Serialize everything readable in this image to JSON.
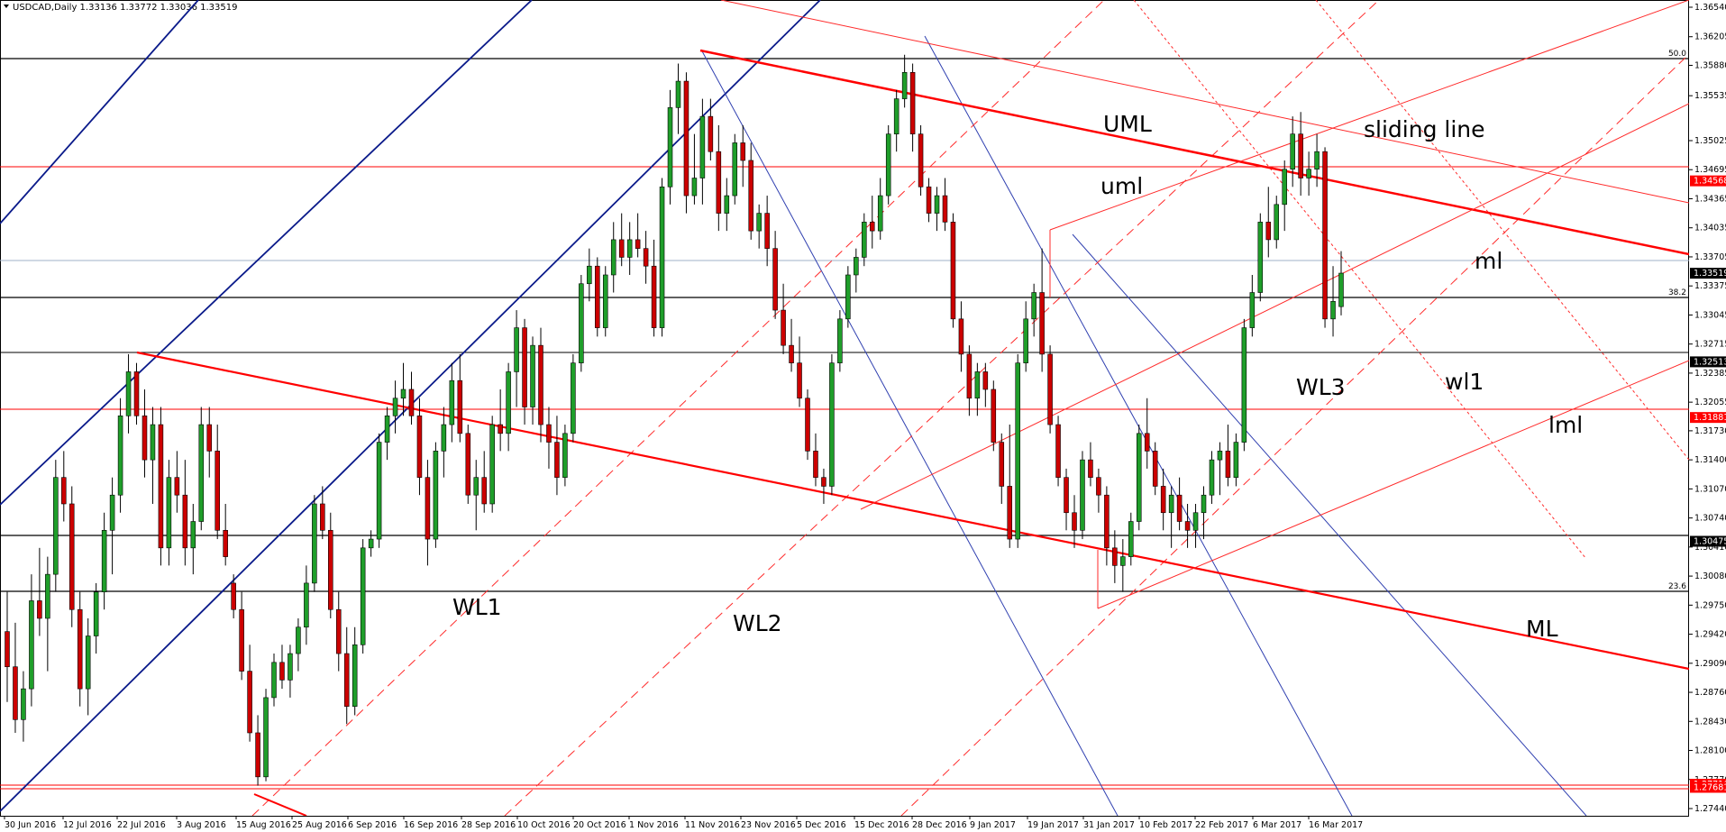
{
  "chart_data": {
    "type": "candlestick",
    "title": "USDCAD,Daily  1.33136 1.33772 1.33036 1.33519",
    "ylim": [
      1.2744,
      1.3654
    ],
    "price_ticks": [
      "1.36540",
      "1.36205",
      "1.35880",
      "1.35535",
      "1.35025",
      "1.34695",
      "1.34365",
      "1.34035",
      "1.33705",
      "1.33375",
      "1.33045",
      "1.32715",
      "1.32385",
      "1.32055",
      "1.31730",
      "1.31400",
      "1.31070",
      "1.30740",
      "1.30410",
      "1.30080",
      "1.29750",
      "1.29420",
      "1.29090",
      "1.28760",
      "1.28430",
      "1.28100",
      "1.27770",
      "1.27440"
    ],
    "date_ticks": [
      "30 Jun 2016",
      "12 Jul 2016",
      "22 Jul 2016",
      "3 Aug 2016",
      "15 Aug 2016",
      "25 Aug 2016",
      "6 Sep 2016",
      "16 Sep 2016",
      "28 Sep 2016",
      "10 Oct 2016",
      "20 Oct 2016",
      "1 Nov 2016",
      "11 Nov 2016",
      "23 Nov 2016",
      "5 Dec 2016",
      "15 Dec 2016",
      "28 Dec 2016",
      "9 Jan 2017",
      "19 Jan 2017",
      "31 Jan 2017",
      "10 Feb 2017",
      "22 Feb 2017",
      "6 Mar 2017",
      "16 Mar 2017"
    ],
    "highlighted_prices": [
      {
        "value": 1.33519,
        "label": "1.33519",
        "color": "#000000"
      },
      {
        "value": 1.34568,
        "label": "1.34568",
        "color": "#ff0000"
      },
      {
        "value": 1.32513,
        "label": "1.32513",
        "color": "#000000"
      },
      {
        "value": 1.31881,
        "label": "1.31881",
        "color": "#ff0000"
      },
      {
        "value": 1.30475,
        "label": "1.30475",
        "color": "#000000"
      },
      {
        "value": 1.27716,
        "label": "1.27716",
        "color": "#ff0000"
      },
      {
        "value": 1.27681,
        "label": "1.27681",
        "color": "#ff0000"
      }
    ],
    "fibonacci_levels": [
      {
        "label": "50.0",
        "value": 1.3574
      },
      {
        "label": "38.2",
        "value": 1.3314
      },
      {
        "label": "23.6",
        "value": 1.2993
      }
    ],
    "annotations": [
      {
        "label": "UML",
        "color": "#000000"
      },
      {
        "label": "sliding line",
        "color": "#000000"
      },
      {
        "label": "uml",
        "color": "#000000"
      },
      {
        "label": "ml",
        "color": "#000000"
      },
      {
        "label": "WL3",
        "color": "#000000"
      },
      {
        "label": "wl1",
        "color": "#000000"
      },
      {
        "label": "lml",
        "color": "#000000"
      },
      {
        "label": "WL1",
        "color": "#000000"
      },
      {
        "label": "WL2",
        "color": "#000000"
      },
      {
        "label": "ML",
        "color": "#000000"
      }
    ],
    "candles": [
      [
        1.2945,
        1.299,
        1.2865,
        1.2905
      ],
      [
        1.2905,
        1.2955,
        1.283,
        1.2845
      ],
      [
        1.2845,
        1.29,
        1.282,
        1.288
      ],
      [
        1.288,
        1.301,
        1.286,
        1.298
      ],
      [
        1.298,
        1.304,
        1.294,
        1.296
      ],
      [
        1.296,
        1.303,
        1.29,
        1.301
      ],
      [
        1.301,
        1.314,
        1.299,
        1.312
      ],
      [
        1.312,
        1.315,
        1.307,
        1.309
      ],
      [
        1.309,
        1.311,
        1.295,
        1.297
      ],
      [
        1.297,
        1.299,
        1.286,
        1.288
      ],
      [
        1.288,
        1.296,
        1.285,
        1.294
      ],
      [
        1.294,
        1.3,
        1.292,
        1.299
      ],
      [
        1.299,
        1.308,
        1.297,
        1.306
      ],
      [
        1.306,
        1.312,
        1.301,
        1.31
      ],
      [
        1.31,
        1.321,
        1.308,
        1.319
      ],
      [
        1.319,
        1.326,
        1.317,
        1.324
      ],
      [
        1.324,
        1.325,
        1.318,
        1.319
      ],
      [
        1.319,
        1.322,
        1.312,
        1.314
      ],
      [
        1.314,
        1.32,
        1.309,
        1.318
      ],
      [
        1.318,
        1.32,
        1.302,
        1.304
      ],
      [
        1.304,
        1.314,
        1.302,
        1.312
      ],
      [
        1.312,
        1.315,
        1.308,
        1.31
      ],
      [
        1.31,
        1.314,
        1.302,
        1.304
      ],
      [
        1.304,
        1.309,
        1.301,
        1.307
      ],
      [
        1.307,
        1.32,
        1.306,
        1.318
      ],
      [
        1.318,
        1.32,
        1.312,
        1.315
      ],
      [
        1.315,
        1.318,
        1.305,
        1.306
      ],
      [
        1.306,
        1.309,
        1.302,
        1.303
      ],
      [
        1.3,
        1.301,
        1.296,
        1.297
      ],
      [
        1.297,
        1.299,
        1.289,
        1.29
      ],
      [
        1.29,
        1.293,
        1.282,
        1.283
      ],
      [
        1.283,
        1.285,
        1.277,
        1.278
      ],
      [
        1.278,
        1.288,
        1.2775,
        1.287
      ],
      [
        1.287,
        1.292,
        1.286,
        1.291
      ],
      [
        1.291,
        1.293,
        1.288,
        1.289
      ],
      [
        1.289,
        1.293,
        1.287,
        1.292
      ],
      [
        1.292,
        1.296,
        1.29,
        1.295
      ],
      [
        1.295,
        1.302,
        1.293,
        1.3
      ],
      [
        1.3,
        1.31,
        1.299,
        1.309
      ],
      [
        1.309,
        1.311,
        1.305,
        1.306
      ],
      [
        1.306,
        1.308,
        1.296,
        1.297
      ],
      [
        1.297,
        1.299,
        1.29,
        1.292
      ],
      [
        1.292,
        1.295,
        1.284,
        1.286
      ],
      [
        1.286,
        1.295,
        1.285,
        1.293
      ],
      [
        1.293,
        1.305,
        1.292,
        1.304
      ],
      [
        1.304,
        1.306,
        1.303,
        1.305
      ],
      [
        1.305,
        1.317,
        1.304,
        1.316
      ],
      [
        1.316,
        1.32,
        1.314,
        1.319
      ],
      [
        1.319,
        1.323,
        1.317,
        1.321
      ],
      [
        1.321,
        1.325,
        1.319,
        1.322
      ],
      [
        1.322,
        1.324,
        1.318,
        1.319
      ],
      [
        1.319,
        1.321,
        1.31,
        1.312
      ],
      [
        1.312,
        1.314,
        1.302,
        1.305
      ],
      [
        1.305,
        1.316,
        1.304,
        1.315
      ],
      [
        1.315,
        1.32,
        1.312,
        1.318
      ],
      [
        1.318,
        1.325,
        1.316,
        1.323
      ],
      [
        1.323,
        1.326,
        1.316,
        1.317
      ],
      [
        1.317,
        1.318,
        1.309,
        1.31
      ],
      [
        1.31,
        1.314,
        1.306,
        1.312
      ],
      [
        1.312,
        1.315,
        1.308,
        1.309
      ],
      [
        1.309,
        1.319,
        1.308,
        1.318
      ],
      [
        1.318,
        1.322,
        1.315,
        1.317
      ],
      [
        1.317,
        1.325,
        1.315,
        1.324
      ],
      [
        1.324,
        1.331,
        1.32,
        1.329
      ],
      [
        1.329,
        1.33,
        1.318,
        1.32
      ],
      [
        1.32,
        1.328,
        1.318,
        1.327
      ],
      [
        1.327,
        1.329,
        1.316,
        1.318
      ],
      [
        1.318,
        1.32,
        1.313,
        1.316
      ],
      [
        1.316,
        1.319,
        1.31,
        1.312
      ],
      [
        1.312,
        1.318,
        1.311,
        1.317
      ],
      [
        1.317,
        1.326,
        1.316,
        1.325
      ],
      [
        1.325,
        1.335,
        1.324,
        1.334
      ],
      [
        1.334,
        1.338,
        1.332,
        1.336
      ],
      [
        1.336,
        1.337,
        1.328,
        1.329
      ],
      [
        1.329,
        1.336,
        1.328,
        1.335
      ],
      [
        1.335,
        1.341,
        1.333,
        1.339
      ],
      [
        1.339,
        1.342,
        1.336,
        1.337
      ],
      [
        1.337,
        1.341,
        1.335,
        1.339
      ],
      [
        1.339,
        1.342,
        1.337,
        1.338
      ],
      [
        1.338,
        1.34,
        1.334,
        1.336
      ],
      [
        1.336,
        1.339,
        1.328,
        1.329
      ],
      [
        1.329,
        1.346,
        1.328,
        1.345
      ],
      [
        1.345,
        1.356,
        1.343,
        1.354
      ],
      [
        1.354,
        1.359,
        1.351,
        1.357
      ],
      [
        1.357,
        1.358,
        1.342,
        1.344
      ],
      [
        1.344,
        1.351,
        1.343,
        1.346
      ],
      [
        1.346,
        1.355,
        1.343,
        1.353
      ],
      [
        1.353,
        1.355,
        1.348,
        1.349
      ],
      [
        1.349,
        1.352,
        1.34,
        1.342
      ],
      [
        1.342,
        1.346,
        1.34,
        1.344
      ],
      [
        1.344,
        1.351,
        1.343,
        1.35
      ],
      [
        1.35,
        1.352,
        1.345,
        1.348
      ],
      [
        1.348,
        1.35,
        1.339,
        1.34
      ],
      [
        1.34,
        1.343,
        1.338,
        1.342
      ],
      [
        1.342,
        1.344,
        1.336,
        1.338
      ],
      [
        1.338,
        1.34,
        1.33,
        1.331
      ],
      [
        1.331,
        1.334,
        1.326,
        1.327
      ],
      [
        1.327,
        1.33,
        1.324,
        1.325
      ],
      [
        1.325,
        1.328,
        1.32,
        1.321
      ],
      [
        1.321,
        1.322,
        1.314,
        1.315
      ],
      [
        1.315,
        1.317,
        1.311,
        1.312
      ],
      [
        1.312,
        1.313,
        1.309,
        1.311
      ],
      [
        1.311,
        1.326,
        1.31,
        1.325
      ],
      [
        1.325,
        1.331,
        1.324,
        1.33
      ],
      [
        1.33,
        1.336,
        1.329,
        1.335
      ],
      [
        1.335,
        1.338,
        1.333,
        1.337
      ],
      [
        1.337,
        1.342,
        1.336,
        1.341
      ],
      [
        1.341,
        1.344,
        1.338,
        1.34
      ],
      [
        1.34,
        1.346,
        1.339,
        1.344
      ],
      [
        1.344,
        1.352,
        1.343,
        1.351
      ],
      [
        1.351,
        1.356,
        1.349,
        1.355
      ],
      [
        1.355,
        1.36,
        1.354,
        1.358
      ],
      [
        1.358,
        1.359,
        1.349,
        1.351
      ],
      [
        1.351,
        1.352,
        1.344,
        1.345
      ],
      [
        1.345,
        1.346,
        1.341,
        1.342
      ],
      [
        1.342,
        1.345,
        1.34,
        1.344
      ],
      [
        1.344,
        1.346,
        1.34,
        1.341
      ],
      [
        1.341,
        1.342,
        1.329,
        1.33
      ],
      [
        1.33,
        1.332,
        1.324,
        1.326
      ],
      [
        1.326,
        1.327,
        1.319,
        1.321
      ],
      [
        1.321,
        1.325,
        1.319,
        1.324
      ],
      [
        1.324,
        1.325,
        1.32,
        1.322
      ],
      [
        1.322,
        1.323,
        1.315,
        1.316
      ],
      [
        1.316,
        1.317,
        1.309,
        1.311
      ],
      [
        1.311,
        1.318,
        1.304,
        1.305
      ],
      [
        1.305,
        1.326,
        1.304,
        1.325
      ],
      [
        1.325,
        1.332,
        1.324,
        1.33
      ],
      [
        1.33,
        1.334,
        1.328,
        1.333
      ],
      [
        1.333,
        1.338,
        1.324,
        1.326
      ],
      [
        1.326,
        1.327,
        1.317,
        1.318
      ],
      [
        1.318,
        1.319,
        1.311,
        1.312
      ],
      [
        1.312,
        1.313,
        1.306,
        1.308
      ],
      [
        1.308,
        1.31,
        1.304,
        1.306
      ],
      [
        1.306,
        1.315,
        1.305,
        1.314
      ],
      [
        1.314,
        1.316,
        1.311,
        1.312
      ],
      [
        1.312,
        1.313,
        1.308,
        1.31
      ],
      [
        1.31,
        1.311,
        1.302,
        1.304
      ],
      [
        1.304,
        1.306,
        1.3,
        1.302
      ],
      [
        1.302,
        1.305,
        1.299,
        1.303
      ],
      [
        1.303,
        1.308,
        1.302,
        1.307
      ],
      [
        1.307,
        1.318,
        1.306,
        1.317
      ],
      [
        1.317,
        1.321,
        1.313,
        1.315
      ],
      [
        1.315,
        1.316,
        1.31,
        1.311
      ],
      [
        1.311,
        1.313,
        1.306,
        1.308
      ],
      [
        1.308,
        1.311,
        1.304,
        1.31
      ],
      [
        1.31,
        1.312,
        1.306,
        1.307
      ],
      [
        1.307,
        1.309,
        1.304,
        1.306
      ],
      [
        1.306,
        1.309,
        1.304,
        1.308
      ],
      [
        1.308,
        1.311,
        1.305,
        1.31
      ],
      [
        1.31,
        1.315,
        1.309,
        1.314
      ],
      [
        1.314,
        1.316,
        1.31,
        1.315
      ],
      [
        1.315,
        1.318,
        1.311,
        1.312
      ],
      [
        1.312,
        1.317,
        1.311,
        1.316
      ],
      [
        1.316,
        1.33,
        1.315,
        1.329
      ],
      [
        1.329,
        1.335,
        1.328,
        1.333
      ],
      [
        1.333,
        1.342,
        1.332,
        1.341
      ],
      [
        1.341,
        1.345,
        1.337,
        1.339
      ],
      [
        1.339,
        1.344,
        1.338,
        1.343
      ],
      [
        1.343,
        1.348,
        1.34,
        1.347
      ],
      [
        1.347,
        1.353,
        1.345,
        1.351
      ],
      [
        1.351,
        1.3535,
        1.344,
        1.346
      ],
      [
        1.346,
        1.349,
        1.344,
        1.347
      ],
      [
        1.347,
        1.351,
        1.345,
        1.349
      ],
      [
        1.349,
        1.3495,
        1.329,
        1.33
      ],
      [
        1.33,
        1.336,
        1.328,
        1.332
      ],
      [
        1.3314,
        1.3377,
        1.3304,
        1.3352
      ]
    ]
  }
}
